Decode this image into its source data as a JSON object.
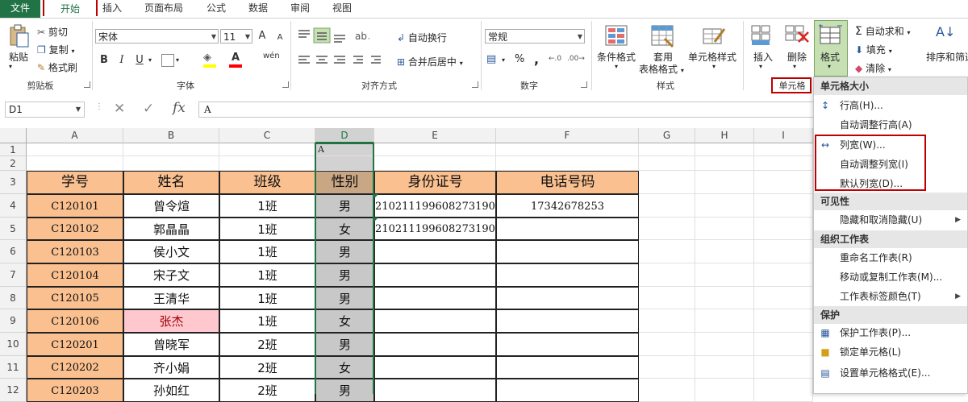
{
  "tabs": {
    "file": "文件",
    "home": "开始",
    "insert": "插入",
    "page_layout": "页面布局",
    "formulas": "公式",
    "data": "数据",
    "review": "审阅",
    "view": "视图"
  },
  "clipboard": {
    "paste": "粘贴",
    "cut": "剪切",
    "copy": "复制",
    "format_painter": "格式刷",
    "group": "剪贴板"
  },
  "font": {
    "name": "宋体",
    "size": "11",
    "bold": "B",
    "italic": "I",
    "underline": "U",
    "grow": "A",
    "shrink": "A",
    "font_color_glyph": "A",
    "phonetic": "wén",
    "group": "字体"
  },
  "alignment": {
    "wrap": "自动换行",
    "merge": "合并后居中",
    "group": "对齐方式"
  },
  "number": {
    "format": "常规",
    "percent": "%",
    "comma": ",",
    "group": "数字"
  },
  "styles": {
    "conditional": "条件格式",
    "table_l1": "套用",
    "table_l2": "表格格式",
    "cell_styles": "单元格样式",
    "group": "样式"
  },
  "cells": {
    "insert": "插入",
    "delete": "删除",
    "format": "格式",
    "group": "单元格"
  },
  "editing": {
    "autosum": "自动求和",
    "fill": "填充",
    "clear": "清除",
    "sort": "排序和筛选"
  },
  "formula_bar": {
    "name_box": "D1",
    "formula": "A",
    "cancel": "✕",
    "enter": "✓",
    "fx": "fx"
  },
  "columns": [
    "A",
    "B",
    "C",
    "D",
    "E",
    "F",
    "G",
    "H",
    "I"
  ],
  "rows": [
    "1",
    "2",
    "3",
    "4",
    "5",
    "6",
    "7",
    "8",
    "9",
    "10",
    "11",
    "12"
  ],
  "d1_value": "A",
  "headers": [
    "学号",
    "姓名",
    "班级",
    "性别",
    "身份证号",
    "电话号码"
  ],
  "records": [
    [
      "C120101",
      "曾令煊",
      "1班",
      "男",
      "210211199608273190",
      "17342678253"
    ],
    [
      "C120102",
      "郭晶晶",
      "1班",
      "女",
      "210211199608273190",
      ""
    ],
    [
      "C120103",
      "侯小文",
      "1班",
      "男",
      "",
      ""
    ],
    [
      "C120104",
      "宋子文",
      "1班",
      "男",
      "",
      ""
    ],
    [
      "C120105",
      "王清华",
      "1班",
      "男",
      "",
      ""
    ],
    [
      "C120106",
      "张杰",
      "1班",
      "女",
      "",
      ""
    ],
    [
      "C120201",
      "曾晓军",
      "2班",
      "男",
      "",
      ""
    ],
    [
      "C120202",
      "齐小娟",
      "2班",
      "女",
      "",
      ""
    ],
    [
      "C120203",
      "孙如红",
      "2班",
      "男",
      "",
      ""
    ]
  ],
  "menu": {
    "size_header": "单元格大小",
    "row_height": "行高(H)...",
    "autofit_row": "自动调整行高(A)",
    "col_width": "列宽(W)...",
    "autofit_col": "自动调整列宽(I)",
    "default_width": "默认列宽(D)...",
    "visibility_header": "可见性",
    "hide_unhide": "隐藏和取消隐藏(U)",
    "organize_header": "组织工作表",
    "rename": "重命名工作表(R)",
    "move_copy": "移动或复制工作表(M)...",
    "tab_color": "工作表标签颜色(T)",
    "protect_header": "保护",
    "protect_sheet": "保护工作表(P)...",
    "lock_cell": "锁定单元格(L)",
    "format_cells": "设置单元格格式(E)..."
  },
  "colors": {
    "accent": "#217346",
    "header_fill": "#fac090",
    "highlight": "#c00000",
    "selection": "#d2d2d2",
    "pink": "#ffc7ce"
  }
}
